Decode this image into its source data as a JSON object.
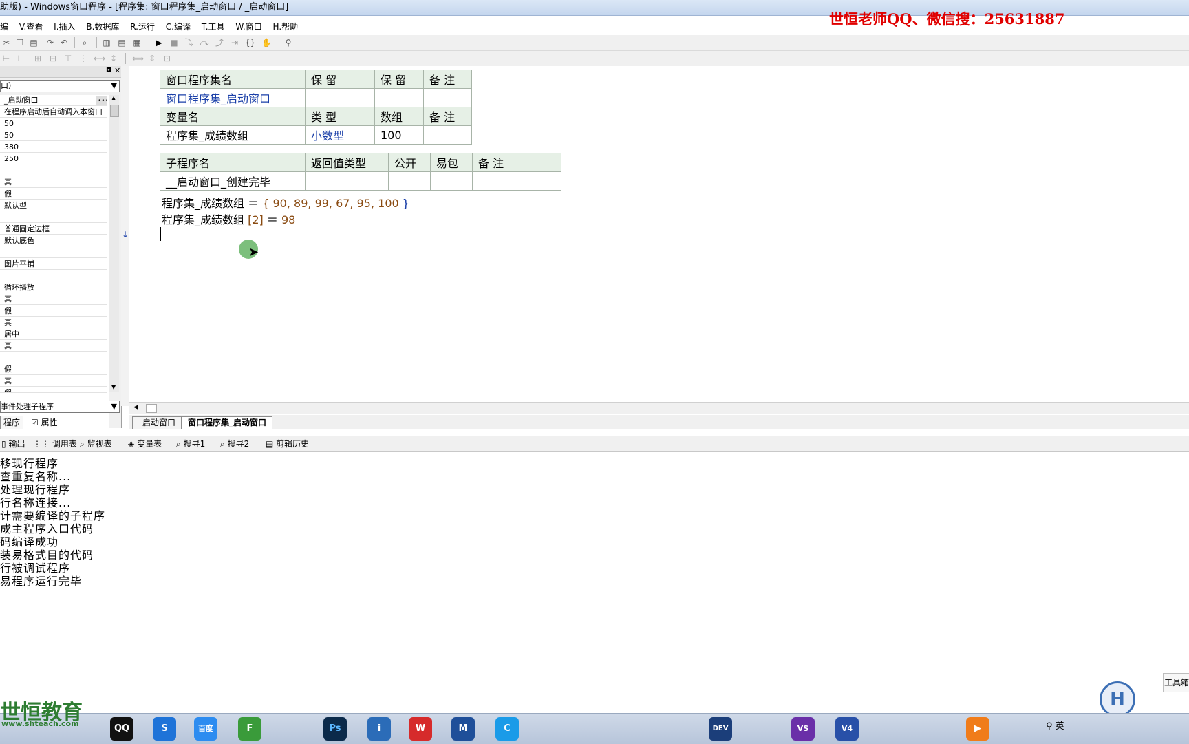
{
  "window": {
    "title": "助版) - Windows窗口程序 - [程序集: 窗口程序集_启动窗口 / _启动窗口]"
  },
  "watermark": {
    "top": "世恒老师QQ、微信搜：25631887",
    "logo": "世恒教育",
    "logo_url": "www.shteach.com"
  },
  "menu": {
    "items": [
      "编",
      "V.查看",
      "I.插入",
      "B.数据库",
      "R.运行",
      "C.编译",
      "T.工具",
      "W.窗口",
      "H.帮助"
    ]
  },
  "left_panel": {
    "combo_value": "口）",
    "properties": [
      "_启动窗口",
      "在程序启动后自动调入本窗口",
      "50",
      "50",
      "380",
      "250",
      "",
      "真",
      "假",
      "默认型",
      "",
      "普通固定边框",
      "默认底色",
      "",
      "图片平铺",
      "",
      "循环播放",
      "真",
      "假",
      "真",
      "居中",
      "真",
      "",
      "假",
      "真",
      "假"
    ],
    "event_combo": "事件处理子程序",
    "tabs": [
      "程序",
      "属性"
    ]
  },
  "editor": {
    "assembly_table": {
      "headers": [
        "窗口程序集名",
        "保 留",
        "保 留",
        "备 注"
      ],
      "row": [
        "窗口程序集_启动窗口",
        "",
        "",
        ""
      ]
    },
    "var_table": {
      "headers": [
        "变量名",
        "类 型",
        "数组",
        "备 注"
      ],
      "row": [
        "程序集_成绩数组",
        "小数型",
        "100",
        ""
      ]
    },
    "sub_table": {
      "headers": [
        "子程序名",
        "返回值类型",
        "公开",
        "易包",
        "备 注"
      ],
      "row": [
        "__启动窗口_创建完毕",
        "",
        "",
        "",
        ""
      ]
    },
    "code_lines": [
      {
        "var": "程序集_成绩数组",
        "op": "＝",
        "open": "{",
        "values": "90, 89, 99, 67, 95, 100",
        "close": "}"
      },
      {
        "var": "程序集_成绩数组",
        "index": "[2]",
        "op": "＝",
        "value": "98"
      }
    ]
  },
  "doc_tabs": [
    "_启动窗口",
    "窗口程序集_启动窗口"
  ],
  "bottom_tabs": [
    "输出",
    "调用表",
    "监视表",
    "变量表",
    "搜寻1",
    "搜寻2",
    "剪辑历史"
  ],
  "output_lines": [
    "移现行程序",
    "查重复名称...",
    "处理现行程序",
    "行名称连接...",
    "计需要编译的子程序",
    "成主程序入口代码",
    "码编译成功",
    "装易格式目的代码",
    "行被调试程序",
    "易程序运行完毕"
  ],
  "taskbar": {
    "buttons": [
      "QQ",
      "S",
      "百度",
      "F",
      "Ps",
      "i",
      "W",
      "M",
      "C",
      "DEV",
      "VS",
      "V4"
    ],
    "tray_text": "英",
    "toolbox_label": "工具箱"
  },
  "colors": {
    "titlebar": "#c4d6ee",
    "table_header": "#e6f0e6",
    "keyword_blue": "#1a3fa8",
    "number_brown": "#8a4b12",
    "watermark_red": "#e00000",
    "logo_green": "#2e7d32"
  }
}
